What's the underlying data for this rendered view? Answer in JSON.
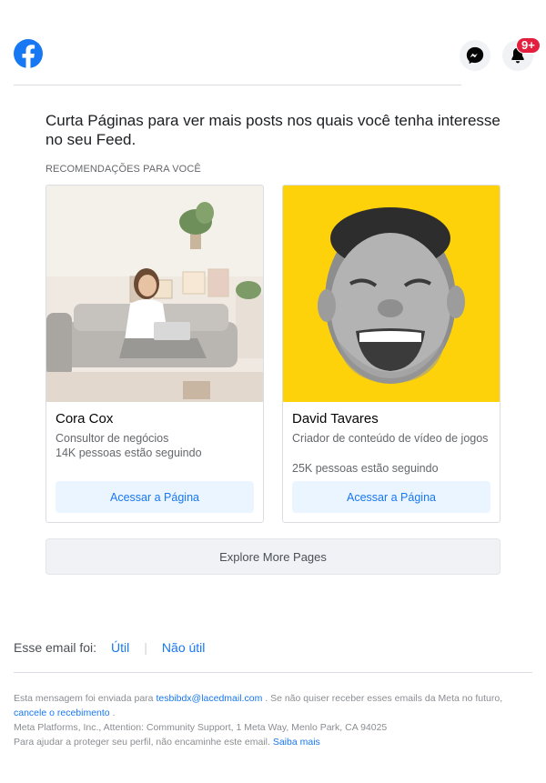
{
  "header": {
    "logo_icon": "facebook-logo",
    "messenger_icon": "messenger-icon",
    "notification_icon": "bell-icon",
    "notification_badge": "9+"
  },
  "headline": "Curta Páginas para ver mais posts nos quais você tenha interesse no seu Feed.",
  "section_label": "RECOMENDAÇÕES PARA VOCÊ",
  "cards": [
    {
      "name": "Cora Cox",
      "category": "Consultor de negócios",
      "followers": "14K pessoas estão seguindo",
      "button": "Acessar a Página"
    },
    {
      "name": "David Tavares",
      "category": "Criador de conteúdo de vídeo de jogos",
      "followers": "25K pessoas estão seguindo",
      "button": "Acessar a Página"
    }
  ],
  "explore_button": "Explore More Pages",
  "feedback": {
    "prompt": "Esse email foi:",
    "useful": "Útil",
    "separator": "|",
    "not_useful": "Não útil"
  },
  "footer": {
    "sent_to_prefix": "Esta mensagem foi enviada para",
    "email": "tesbibdx@lacedmail.com",
    "sent_to_suffix": ". Se não quiser receber esses emails da Meta no futuro,",
    "unsubscribe": "cancele o recebimento",
    "unsubscribe_suffix": ".",
    "address": "Meta Platforms, Inc., Attention: Community Support, 1 Meta Way, Menlo Park, CA 94025",
    "protect_text": "Para ajudar a proteger seu perfil, não encaminhe este email.",
    "learn_more": "Saiba mais"
  },
  "colors": {
    "brand_blue": "#1877f2",
    "badge_red": "#e41e3f",
    "card2_bg": "#fdd20a"
  }
}
